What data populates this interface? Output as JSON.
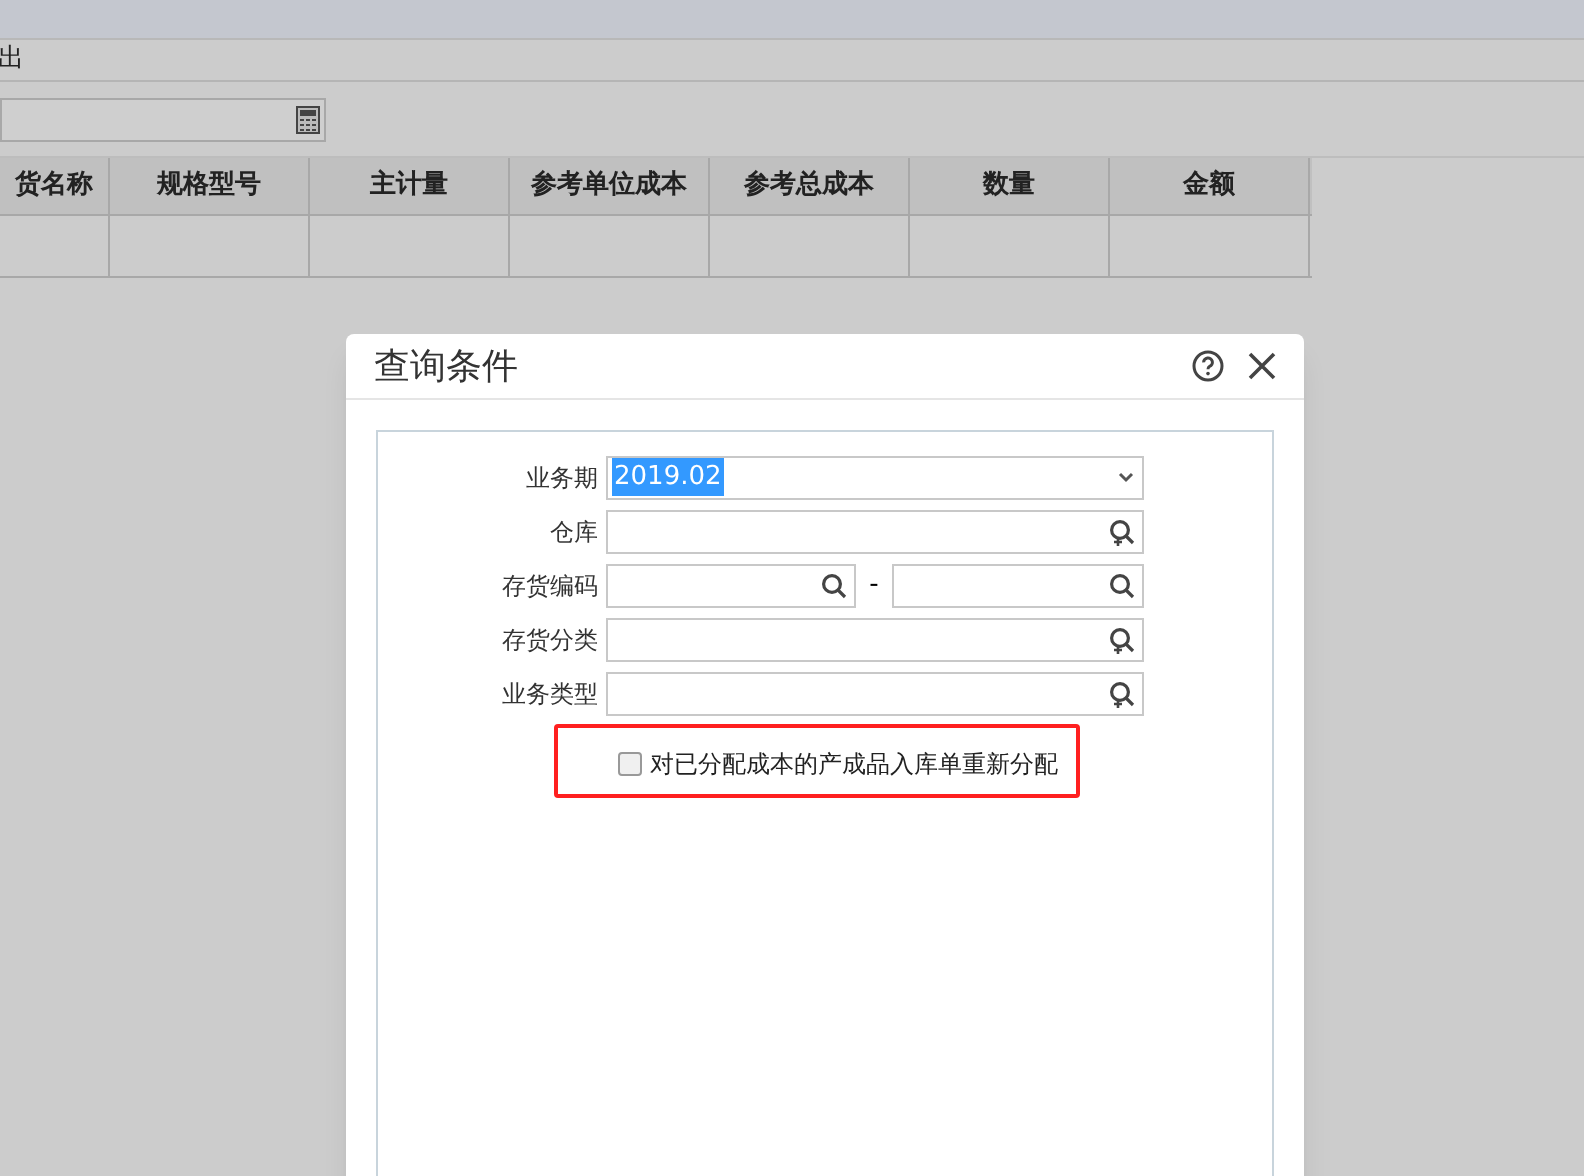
{
  "toolbar": {
    "label": "出"
  },
  "table": {
    "columns": [
      "货名称",
      "规格型号",
      "主计量",
      "参考单位成本",
      "参考总成本",
      "数量",
      "金额"
    ],
    "rows": [
      [
        "",
        "",
        "",
        "",
        "",
        "",
        ""
      ]
    ]
  },
  "dialog": {
    "title": "查询条件",
    "fields": [
      {
        "kind": "select",
        "label": "业务期",
        "value": "2019.02",
        "value_highlighted": true
      },
      {
        "kind": "lookup",
        "label": "仓库"
      },
      {
        "kind": "range",
        "label": "存货编码",
        "separator": "-"
      },
      {
        "kind": "lookup",
        "label": "存货分类"
      },
      {
        "kind": "lookup",
        "label": "业务类型"
      }
    ],
    "checkbox": {
      "label": "对已分配成本的产成品入库单重新分配",
      "checked": false,
      "highlighted": true
    }
  }
}
